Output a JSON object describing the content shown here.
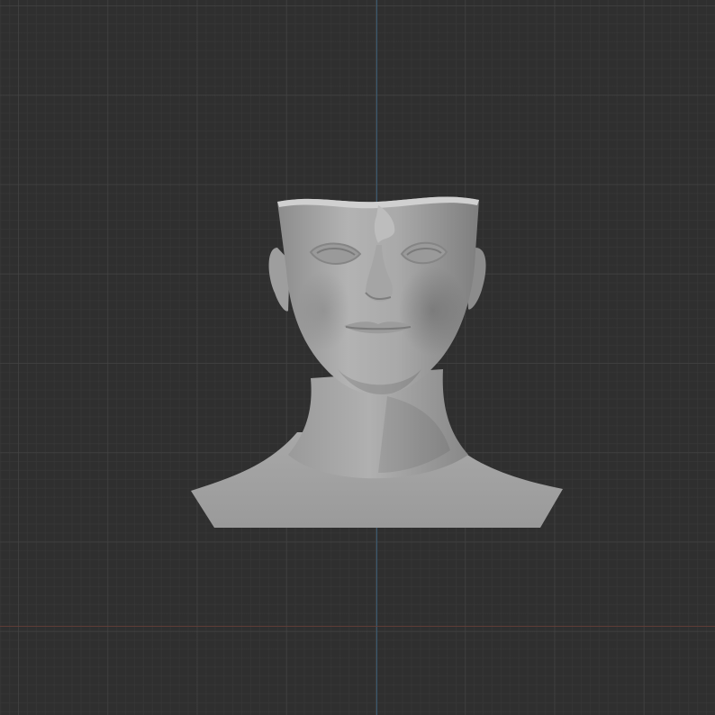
{
  "viewport": {
    "background_color": "#303030",
    "grid_minor_color": "#3a3a3a",
    "grid_major_color": "#464646",
    "z_axis_color": "#3a5f7a",
    "x_axis_color": "#6a4038"
  },
  "scene": {
    "object_type": "head-bust-mesh",
    "mesh_color": "#a3a3a3"
  }
}
